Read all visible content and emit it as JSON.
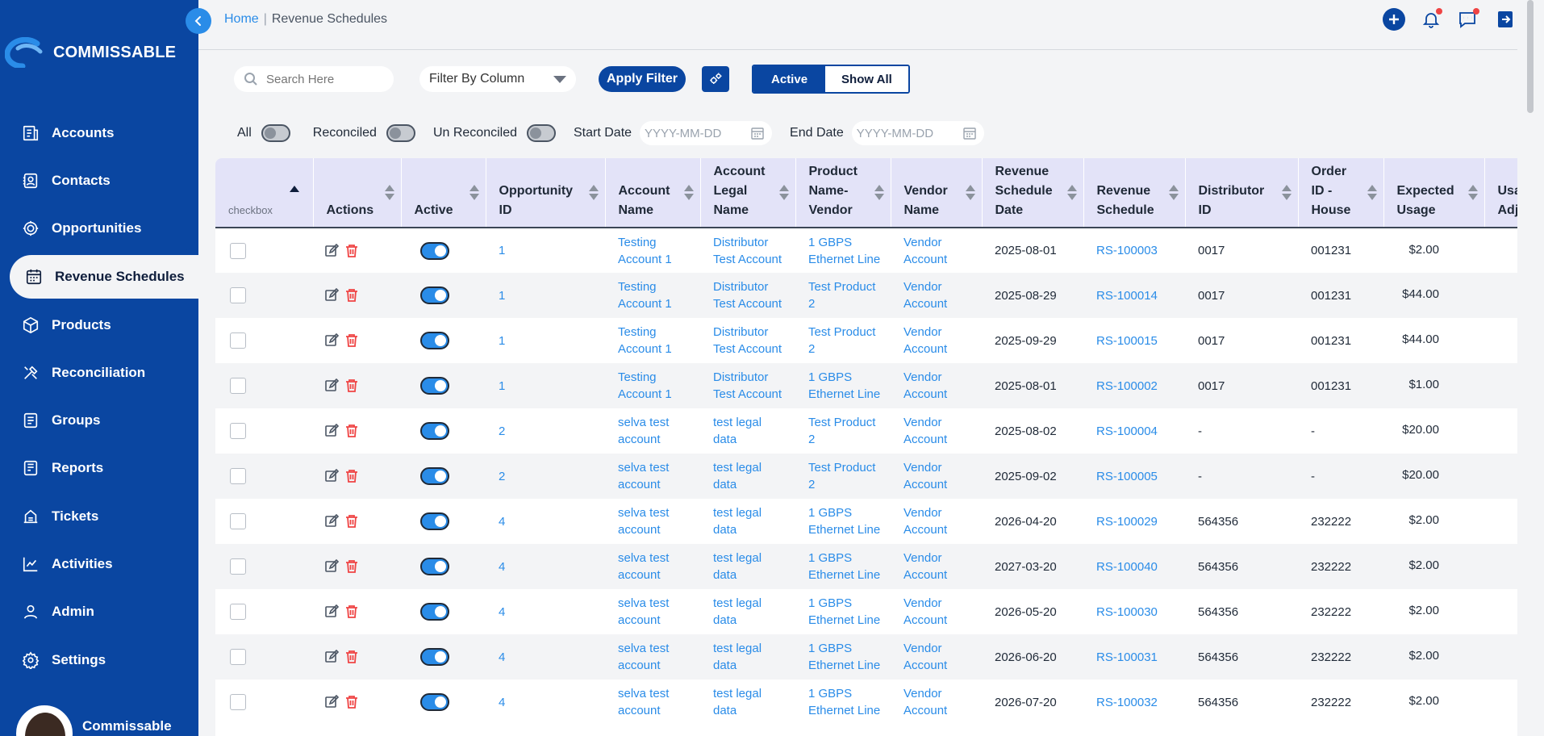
{
  "brand": {
    "name": "COMMISSABLE"
  },
  "breadcrumb": {
    "home": "Home",
    "separator": "|",
    "current": "Revenue Schedules"
  },
  "nav": {
    "items": [
      {
        "label": "Accounts",
        "icon": "accounts-icon"
      },
      {
        "label": "Contacts",
        "icon": "contacts-icon"
      },
      {
        "label": "Opportunities",
        "icon": "opportunities-icon"
      },
      {
        "label": "Revenue Schedules",
        "icon": "calendar-icon",
        "active": true
      },
      {
        "label": "Products",
        "icon": "box-icon"
      },
      {
        "label": "Reconciliation",
        "icon": "tools-icon"
      },
      {
        "label": "Groups",
        "icon": "groups-icon"
      },
      {
        "label": "Reports",
        "icon": "reports-icon"
      },
      {
        "label": "Tickets",
        "icon": "tickets-icon"
      },
      {
        "label": "Activities",
        "icon": "chart-line-icon"
      },
      {
        "label": "Admin",
        "icon": "user-icon"
      },
      {
        "label": "Settings",
        "icon": "gear-icon"
      }
    ]
  },
  "user": {
    "name": "Commissable"
  },
  "toolbar": {
    "search_placeholder": "Search Here",
    "filter_select": "Filter By Column",
    "apply_label": "Apply Filter",
    "active_label": "Active",
    "show_all_label": "Show All"
  },
  "filters": {
    "all_label": "All",
    "reconciled_label": "Reconciled",
    "unreconciled_label": "Un Reconciled",
    "start_label": "Start Date",
    "end_label": "End Date",
    "date_placeholder": "YYYY-MM-DD"
  },
  "table": {
    "checkbox_header": "checkbox",
    "columns": [
      "Actions",
      "Active",
      "Opportunity ID",
      "Account Name",
      "Account Legal Name",
      "Product Name-Vendor",
      "Vendor Name",
      "Revenue Schedule Date",
      "Revenue Schedule",
      "Distributor ID",
      "Order ID - House",
      "Expected Usage",
      "Usage Adj"
    ],
    "rows": [
      [
        "1",
        "Testing Account 1",
        "Distributor Test Account",
        "1 GBPS Ethernet Line",
        "Vendor Account",
        "2025-08-01",
        "RS-100003",
        "0017",
        "001231",
        "$2.00"
      ],
      [
        "1",
        "Testing Account 1",
        "Distributor Test Account",
        "Test Product 2",
        "Vendor Account",
        "2025-08-29",
        "RS-100014",
        "0017",
        "001231",
        "$44.00"
      ],
      [
        "1",
        "Testing Account 1",
        "Distributor Test Account",
        "Test Product 2",
        "Vendor Account",
        "2025-09-29",
        "RS-100015",
        "0017",
        "001231",
        "$44.00"
      ],
      [
        "1",
        "Testing Account 1",
        "Distributor Test Account",
        "1 GBPS Ethernet Line",
        "Vendor Account",
        "2025-08-01",
        "RS-100002",
        "0017",
        "001231",
        "$1.00"
      ],
      [
        "2",
        "selva test account",
        "test legal data",
        "Test Product 2",
        "Vendor Account",
        "2025-08-02",
        "RS-100004",
        "-",
        "-",
        "$20.00"
      ],
      [
        "2",
        "selva test account",
        "test legal data",
        "Test Product 2",
        "Vendor Account",
        "2025-09-02",
        "RS-100005",
        "-",
        "-",
        "$20.00"
      ],
      [
        "4",
        "selva test account",
        "test legal data",
        "1 GBPS Ethernet Line",
        "Vendor Account",
        "2026-04-20",
        "RS-100029",
        "564356",
        "232222",
        "$2.00"
      ],
      [
        "4",
        "selva test account",
        "test legal data",
        "1 GBPS Ethernet Line",
        "Vendor Account",
        "2027-03-20",
        "RS-100040",
        "564356",
        "232222",
        "$2.00"
      ],
      [
        "4",
        "selva test account",
        "test legal data",
        "1 GBPS Ethernet Line",
        "Vendor Account",
        "2026-05-20",
        "RS-100030",
        "564356",
        "232222",
        "$2.00"
      ],
      [
        "4",
        "selva test account",
        "test legal data",
        "1 GBPS Ethernet Line",
        "Vendor Account",
        "2026-06-20",
        "RS-100031",
        "564356",
        "232222",
        "$2.00"
      ],
      [
        "4",
        "selva test account",
        "test legal data",
        "1 GBPS Ethernet Line",
        "Vendor Account",
        "2026-07-20",
        "RS-100032",
        "564356",
        "232222",
        "$2.00"
      ]
    ]
  },
  "colors": {
    "brand": "#0a46a1",
    "accent": "#2a8ce8",
    "header_bg": "#e3e3f8",
    "danger": "#ef4444"
  }
}
